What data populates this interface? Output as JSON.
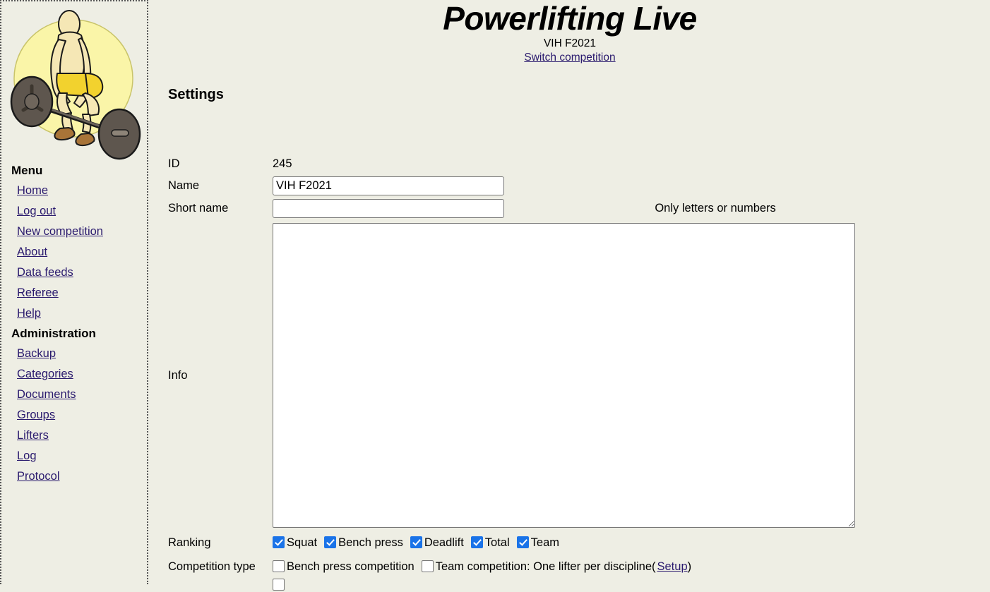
{
  "header": {
    "brand_title": "Powerlifting Live",
    "competition_name": "VIH F2021",
    "switch_link": "Switch competition"
  },
  "sidebar": {
    "logo_alt": "powerlifter-deadlift-logo",
    "menu_heading": "Menu",
    "menu_items": [
      {
        "label": "Home"
      },
      {
        "label": "Log out"
      },
      {
        "label": "New competition"
      },
      {
        "label": "About"
      },
      {
        "label": "Data feeds"
      },
      {
        "label": "Referee"
      },
      {
        "label": "Help"
      }
    ],
    "admin_heading": "Administration",
    "admin_items": [
      {
        "label": "Backup"
      },
      {
        "label": "Categories"
      },
      {
        "label": "Documents"
      },
      {
        "label": "Groups"
      },
      {
        "label": "Lifters"
      },
      {
        "label": "Log"
      },
      {
        "label": "Protocol"
      }
    ]
  },
  "main": {
    "section_title": "Settings",
    "fields": {
      "id_label": "ID",
      "id_value": "245",
      "name_label": "Name",
      "name_value": "VIH F2021",
      "short_name_label": "Short name",
      "short_name_value": "",
      "short_name_hint": "Only letters or numbers",
      "info_label": "Info",
      "info_value": "",
      "ranking_label": "Ranking",
      "competition_type_label": "Competition type"
    },
    "ranking_checkboxes": [
      {
        "label": "Squat",
        "checked": true
      },
      {
        "label": "Bench press",
        "checked": true
      },
      {
        "label": "Deadlift",
        "checked": true
      },
      {
        "label": "Total",
        "checked": true
      },
      {
        "label": "Team",
        "checked": true
      }
    ],
    "competition_type_checkboxes": [
      {
        "label": "Bench press competition",
        "checked": false
      },
      {
        "label": "Team competition: One lifter per discipline(",
        "checked": false
      }
    ],
    "setup_link": "Setup",
    "close_paren": ")"
  },
  "colors": {
    "page_background": "#eeeee4",
    "link": "#2a1a6e",
    "checkbox_checked": "#1a73e8",
    "input_border": "#767676",
    "text": "#000000",
    "logo_circle": "#faf5a8",
    "logo_skin": "#f5e7b5",
    "logo_shorts": "#f2d22e",
    "logo_plate": "#5e564e"
  }
}
